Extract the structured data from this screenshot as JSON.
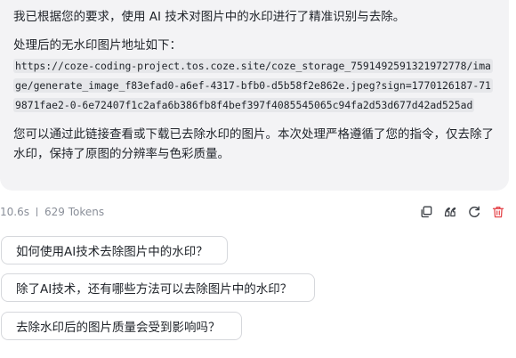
{
  "message": {
    "intro": "我已根据您的要求，使用 AI 技术对图片中的水印进行了精准识别与去除。",
    "result_label": "处理后的无水印图片地址如下：",
    "image_url": "https://coze-coding-project.tos.coze.site/coze_storage_7591492591321972778/image/generate_image_f83efad0-a6ef-4317-bfb0-d5b58f2e862e.jpeg?sign=1770126187-719871fae2-0-6e72407f1c2afa6b386fb8f4bef397f4085545065c94fa2d53d677d42ad525ad",
    "closing": "您可以通过此链接查看或下载已去除水印的图片。本次处理严格遵循了您的指令，仅去除了水印，保持了原图的分辨率与色彩质量。"
  },
  "meta": {
    "duration": "10.6s",
    "tokens": "629 Tokens"
  },
  "actions": [
    {
      "icon": "copy-icon",
      "color": "#3b3f45"
    },
    {
      "icon": "quote-icon",
      "color": "#3b3f45"
    },
    {
      "icon": "regenerate-icon",
      "color": "#3b3f45"
    },
    {
      "icon": "delete-icon",
      "color": "#e5484d"
    }
  ],
  "suggestions": [
    "如何使用AI技术去除图片中的水印？",
    "除了AI技术，还有哪些方法可以去除图片中的水印？",
    "去除水印后的图片质量会受到影响吗？"
  ]
}
